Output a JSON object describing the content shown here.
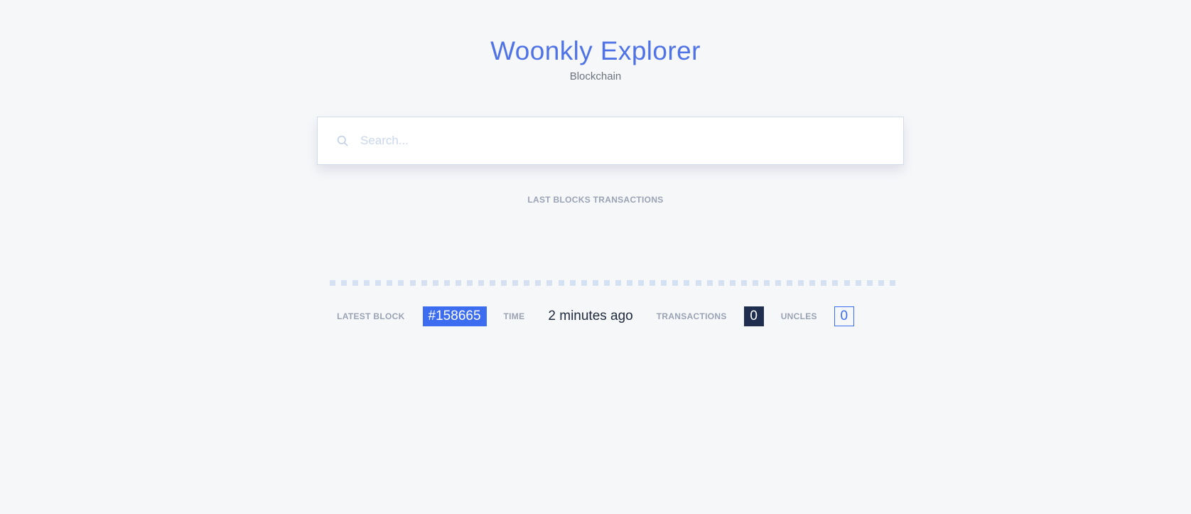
{
  "header": {
    "title": "Woonkly Explorer",
    "subtitle": "Blockchain"
  },
  "search": {
    "placeholder": "Search...",
    "value": "",
    "icon": "search-icon"
  },
  "blocks": {
    "label": "LAST BLOCKS TRANSACTIONS",
    "strip_count": 50
  },
  "status": {
    "latest_block_label": "LATEST BLOCK",
    "latest_block_value": "#158665",
    "time_label": "TIME",
    "time_value": "2 minutes ago",
    "transactions_label": "TRANSACTIONS",
    "transactions_value": "0",
    "uncles_label": "UNCLES",
    "uncles_value": "0"
  },
  "colors": {
    "accent": "#3c6cf0",
    "title": "#4f73e6",
    "dark": "#1f2d4f",
    "background": "#f6f7f9"
  }
}
